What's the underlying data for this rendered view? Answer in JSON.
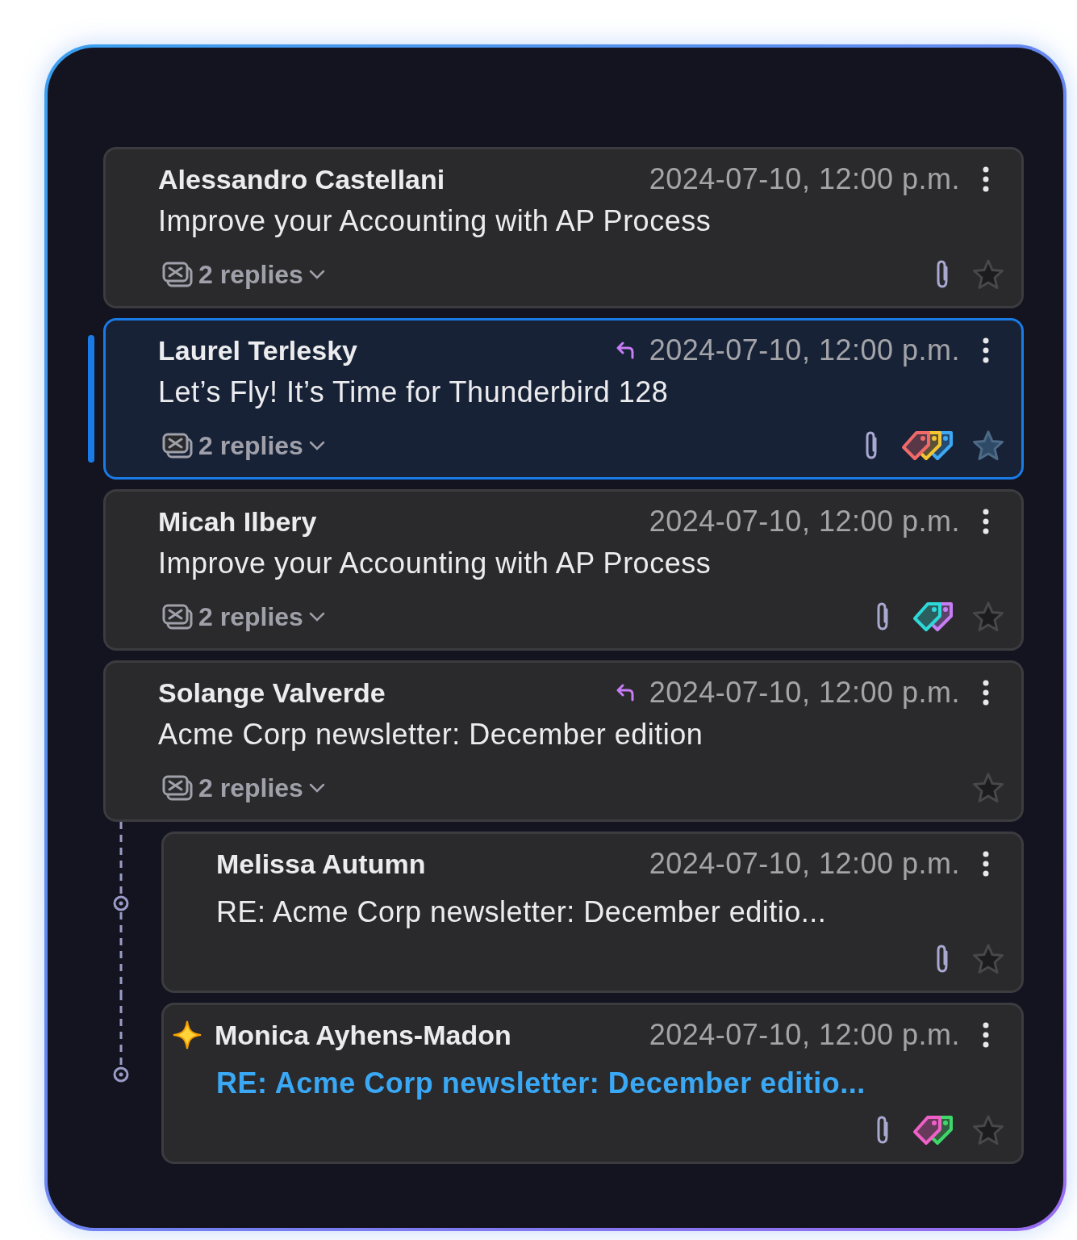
{
  "messages": [
    {
      "sender": "Alessandro Castellani",
      "date": "2024-07-10, 12:00 p.m.",
      "subject": "Improve your Accounting with AP Process",
      "replies": "2 replies",
      "replied": false,
      "attachment": true,
      "selected": false,
      "unread": false,
      "new": false
    },
    {
      "sender": "Laurel Terlesky",
      "date": "2024-07-10, 12:00 p.m.",
      "subject": "Let’s Fly! It’s Time for Thunderbird 128",
      "replies": "2 replies",
      "replied": true,
      "attachment": true,
      "tags": [
        {
          "color": "#f06a6a"
        },
        {
          "color": "#f5c431"
        },
        {
          "color": "#3ea8f5"
        }
      ],
      "selected": true,
      "unread": false,
      "new": false
    },
    {
      "sender": "Micah Ilbery",
      "date": "2024-07-10, 12:00 p.m.",
      "subject": "Improve your Accounting with AP Process",
      "replies": "2 replies",
      "replied": false,
      "attachment": true,
      "tags": [
        {
          "color": "#2ed8d8"
        },
        {
          "color": "#c77df5"
        }
      ],
      "selected": false,
      "unread": false,
      "new": false
    },
    {
      "sender": "Solange Valverde",
      "date": "2024-07-10, 12:00 p.m.",
      "subject": "Acme Corp newsletter: December edition",
      "replies": "2 replies",
      "replied": true,
      "attachment": false,
      "selected": false,
      "unread": false,
      "new": false,
      "children": [
        {
          "sender": "Melissa Autumn",
          "date": "2024-07-10, 12:00 p.m.",
          "subject": "RE: Acme Corp newsletter: December editio...",
          "replied": false,
          "attachment": true,
          "selected": false,
          "unread": false,
          "new": false
        },
        {
          "sender": "Monica Ayhens-Madon",
          "date": "2024-07-10, 12:00 p.m.",
          "subject": "RE: Acme Corp newsletter: December editio...",
          "replied": false,
          "attachment": true,
          "tags": [
            {
              "color": "#f060c8"
            },
            {
              "color": "#3ed86a"
            }
          ],
          "selected": false,
          "unread": true,
          "new": true
        }
      ]
    }
  ]
}
